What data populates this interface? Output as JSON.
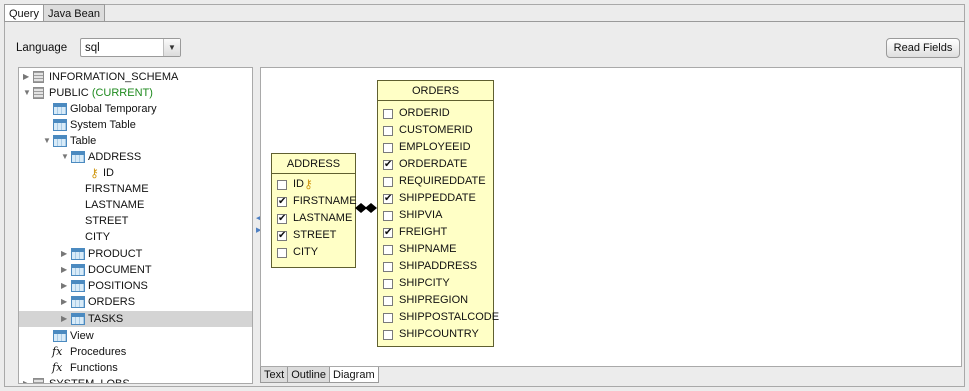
{
  "tabs": [
    {
      "label": "Query",
      "active": true
    },
    {
      "label": "Java Bean",
      "active": false
    }
  ],
  "language": {
    "label": "Language",
    "value": "sql"
  },
  "read_fields_label": "Read Fields",
  "tree": {
    "items": [
      {
        "label": "INFORMATION_SCHEMA",
        "icon": "database-icon"
      },
      {
        "label": "PUBLIC",
        "suffix": "(CURRENT)",
        "icon": "database-icon"
      },
      {
        "label": "Global Temporary",
        "icon": "table-icon"
      },
      {
        "label": "System Table",
        "icon": "table-icon"
      },
      {
        "label": "Table",
        "icon": "table-icon"
      },
      {
        "label": "ADDRESS",
        "icon": "table-icon"
      },
      {
        "label": "ID",
        "icon": "key-icon"
      },
      {
        "label": "FIRSTNAME"
      },
      {
        "label": "LASTNAME"
      },
      {
        "label": "STREET"
      },
      {
        "label": "CITY"
      },
      {
        "label": "PRODUCT",
        "icon": "table-icon"
      },
      {
        "label": "DOCUMENT",
        "icon": "table-icon"
      },
      {
        "label": "POSITIONS",
        "icon": "table-icon"
      },
      {
        "label": "ORDERS",
        "icon": "table-icon"
      },
      {
        "label": "TASKS",
        "icon": "table-icon",
        "selected": true
      },
      {
        "label": "View",
        "icon": "table-icon"
      },
      {
        "label": "Procedures",
        "icon": "fx-icon"
      },
      {
        "label": "Functions",
        "icon": "fx-icon"
      },
      {
        "label": "SYSTEM_LOBS",
        "icon": "database-icon"
      }
    ]
  },
  "diagram": {
    "address": {
      "title": "ADDRESS",
      "fields": [
        {
          "name": "ID",
          "checked": false,
          "key": true
        },
        {
          "name": "FIRSTNAME",
          "checked": true
        },
        {
          "name": "LASTNAME",
          "checked": true
        },
        {
          "name": "STREET",
          "checked": true
        },
        {
          "name": "CITY",
          "checked": false
        }
      ]
    },
    "orders": {
      "title": "ORDERS",
      "fields": [
        {
          "name": "ORDERID",
          "checked": false
        },
        {
          "name": "CUSTOMERID",
          "checked": false
        },
        {
          "name": "EMPLOYEEID",
          "checked": false
        },
        {
          "name": "ORDERDATE",
          "checked": true
        },
        {
          "name": "REQUIREDDATE",
          "checked": false
        },
        {
          "name": "SHIPPEDDATE",
          "checked": true
        },
        {
          "name": "SHIPVIA",
          "checked": false
        },
        {
          "name": "FREIGHT",
          "checked": true
        },
        {
          "name": "SHIPNAME",
          "checked": false
        },
        {
          "name": "SHIPADDRESS",
          "checked": false
        },
        {
          "name": "SHIPCITY",
          "checked": false
        },
        {
          "name": "SHIPREGION",
          "checked": false
        },
        {
          "name": "SHIPPOSTALCODE",
          "checked": false
        },
        {
          "name": "SHIPCOUNTRY",
          "checked": false
        }
      ]
    }
  },
  "bottom_tabs": [
    {
      "label": "Text",
      "active": false
    },
    {
      "label": "Outline",
      "active": false
    },
    {
      "label": "Diagram",
      "active": true
    }
  ],
  "colors": {
    "entity_fill": "#ffffc6",
    "current_label": "#1e8a1e",
    "selection": "#d4d4d4"
  }
}
